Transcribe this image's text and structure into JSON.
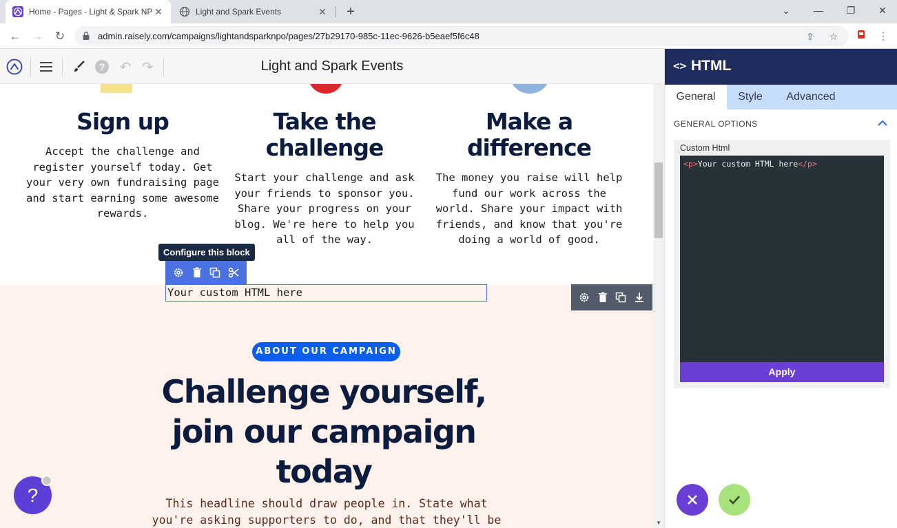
{
  "browser": {
    "tabs": [
      {
        "title": "Home - Pages - Light & Spark NPO",
        "active": true
      },
      {
        "title": "Light and Spark Events",
        "active": false
      }
    ],
    "url": "admin.raisely.com/campaigns/lightandsparknpo/pages/27b29170-985c-11ec-9626-b5eaef5f6c48"
  },
  "editor": {
    "title": "Light and Spark Events"
  },
  "steps": [
    {
      "title": "Sign up",
      "text": "Accept the challenge and register yourself today. Get your very own fundraising page and start earning some awesome rewards."
    },
    {
      "title": "Take the challenge",
      "text": "Start your challenge and ask your friends to sponsor you. Share your progress on your blog. We're here to help you all of the way."
    },
    {
      "title": "Make a difference",
      "text": "The money you raise will help fund our work across the world. Share your impact with friends, and know that you're doing a world of good."
    }
  ],
  "block": {
    "tooltip": "Configure this block",
    "html_text": "Your custom HTML here"
  },
  "campaign": {
    "pill": "ABOUT OUR CAMPAIGN",
    "headline": "Challenge yourself, join our campaign today",
    "lede": "This headline should draw people in. State what you're asking supporters to do, and that they'll be"
  },
  "help": {
    "label": "?"
  },
  "panel": {
    "title": "HTML",
    "tabs": [
      "General",
      "Style",
      "Advanced"
    ],
    "section": "GENERAL OPTIONS",
    "field_label": "Custom Html",
    "code": {
      "open": "<p>",
      "text": "Your custom HTML here",
      "close": "</p>"
    },
    "apply": "Apply"
  },
  "colors": {
    "accent": "#6a3fd7",
    "navy": "#212c5f",
    "pink_bg": "#fff1ec",
    "pill_blue": "#0a5ee7"
  }
}
